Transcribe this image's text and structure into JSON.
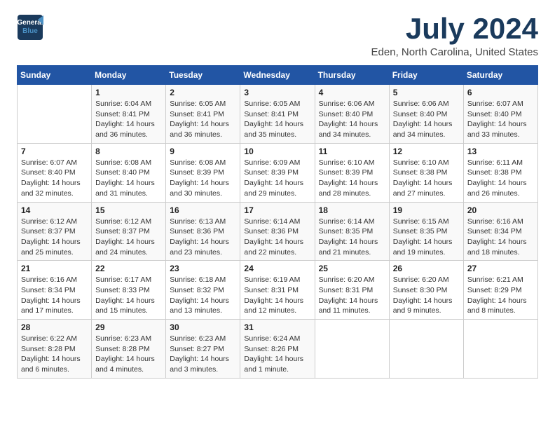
{
  "header": {
    "logo_line1": "General",
    "logo_line2": "Blue",
    "main_title": "July 2024",
    "subtitle": "Eden, North Carolina, United States"
  },
  "days_of_week": [
    "Sunday",
    "Monday",
    "Tuesday",
    "Wednesday",
    "Thursday",
    "Friday",
    "Saturday"
  ],
  "weeks": [
    [
      {
        "num": "",
        "info": ""
      },
      {
        "num": "1",
        "info": "Sunrise: 6:04 AM\nSunset: 8:41 PM\nDaylight: 14 hours\nand 36 minutes."
      },
      {
        "num": "2",
        "info": "Sunrise: 6:05 AM\nSunset: 8:41 PM\nDaylight: 14 hours\nand 36 minutes."
      },
      {
        "num": "3",
        "info": "Sunrise: 6:05 AM\nSunset: 8:41 PM\nDaylight: 14 hours\nand 35 minutes."
      },
      {
        "num": "4",
        "info": "Sunrise: 6:06 AM\nSunset: 8:40 PM\nDaylight: 14 hours\nand 34 minutes."
      },
      {
        "num": "5",
        "info": "Sunrise: 6:06 AM\nSunset: 8:40 PM\nDaylight: 14 hours\nand 34 minutes."
      },
      {
        "num": "6",
        "info": "Sunrise: 6:07 AM\nSunset: 8:40 PM\nDaylight: 14 hours\nand 33 minutes."
      }
    ],
    [
      {
        "num": "7",
        "info": "Sunrise: 6:07 AM\nSunset: 8:40 PM\nDaylight: 14 hours\nand 32 minutes."
      },
      {
        "num": "8",
        "info": "Sunrise: 6:08 AM\nSunset: 8:40 PM\nDaylight: 14 hours\nand 31 minutes."
      },
      {
        "num": "9",
        "info": "Sunrise: 6:08 AM\nSunset: 8:39 PM\nDaylight: 14 hours\nand 30 minutes."
      },
      {
        "num": "10",
        "info": "Sunrise: 6:09 AM\nSunset: 8:39 PM\nDaylight: 14 hours\nand 29 minutes."
      },
      {
        "num": "11",
        "info": "Sunrise: 6:10 AM\nSunset: 8:39 PM\nDaylight: 14 hours\nand 28 minutes."
      },
      {
        "num": "12",
        "info": "Sunrise: 6:10 AM\nSunset: 8:38 PM\nDaylight: 14 hours\nand 27 minutes."
      },
      {
        "num": "13",
        "info": "Sunrise: 6:11 AM\nSunset: 8:38 PM\nDaylight: 14 hours\nand 26 minutes."
      }
    ],
    [
      {
        "num": "14",
        "info": "Sunrise: 6:12 AM\nSunset: 8:37 PM\nDaylight: 14 hours\nand 25 minutes."
      },
      {
        "num": "15",
        "info": "Sunrise: 6:12 AM\nSunset: 8:37 PM\nDaylight: 14 hours\nand 24 minutes."
      },
      {
        "num": "16",
        "info": "Sunrise: 6:13 AM\nSunset: 8:36 PM\nDaylight: 14 hours\nand 23 minutes."
      },
      {
        "num": "17",
        "info": "Sunrise: 6:14 AM\nSunset: 8:36 PM\nDaylight: 14 hours\nand 22 minutes."
      },
      {
        "num": "18",
        "info": "Sunrise: 6:14 AM\nSunset: 8:35 PM\nDaylight: 14 hours\nand 21 minutes."
      },
      {
        "num": "19",
        "info": "Sunrise: 6:15 AM\nSunset: 8:35 PM\nDaylight: 14 hours\nand 19 minutes."
      },
      {
        "num": "20",
        "info": "Sunrise: 6:16 AM\nSunset: 8:34 PM\nDaylight: 14 hours\nand 18 minutes."
      }
    ],
    [
      {
        "num": "21",
        "info": "Sunrise: 6:16 AM\nSunset: 8:34 PM\nDaylight: 14 hours\nand 17 minutes."
      },
      {
        "num": "22",
        "info": "Sunrise: 6:17 AM\nSunset: 8:33 PM\nDaylight: 14 hours\nand 15 minutes."
      },
      {
        "num": "23",
        "info": "Sunrise: 6:18 AM\nSunset: 8:32 PM\nDaylight: 14 hours\nand 13 minutes."
      },
      {
        "num": "24",
        "info": "Sunrise: 6:19 AM\nSunset: 8:31 PM\nDaylight: 14 hours\nand 12 minutes."
      },
      {
        "num": "25",
        "info": "Sunrise: 6:20 AM\nSunset: 8:31 PM\nDaylight: 14 hours\nand 11 minutes."
      },
      {
        "num": "26",
        "info": "Sunrise: 6:20 AM\nSunset: 8:30 PM\nDaylight: 14 hours\nand 9 minutes."
      },
      {
        "num": "27",
        "info": "Sunrise: 6:21 AM\nSunset: 8:29 PM\nDaylight: 14 hours\nand 8 minutes."
      }
    ],
    [
      {
        "num": "28",
        "info": "Sunrise: 6:22 AM\nSunset: 8:28 PM\nDaylight: 14 hours\nand 6 minutes."
      },
      {
        "num": "29",
        "info": "Sunrise: 6:23 AM\nSunset: 8:28 PM\nDaylight: 14 hours\nand 4 minutes."
      },
      {
        "num": "30",
        "info": "Sunrise: 6:23 AM\nSunset: 8:27 PM\nDaylight: 14 hours\nand 3 minutes."
      },
      {
        "num": "31",
        "info": "Sunrise: 6:24 AM\nSunset: 8:26 PM\nDaylight: 14 hours\nand 1 minute."
      },
      {
        "num": "",
        "info": ""
      },
      {
        "num": "",
        "info": ""
      },
      {
        "num": "",
        "info": ""
      }
    ]
  ]
}
